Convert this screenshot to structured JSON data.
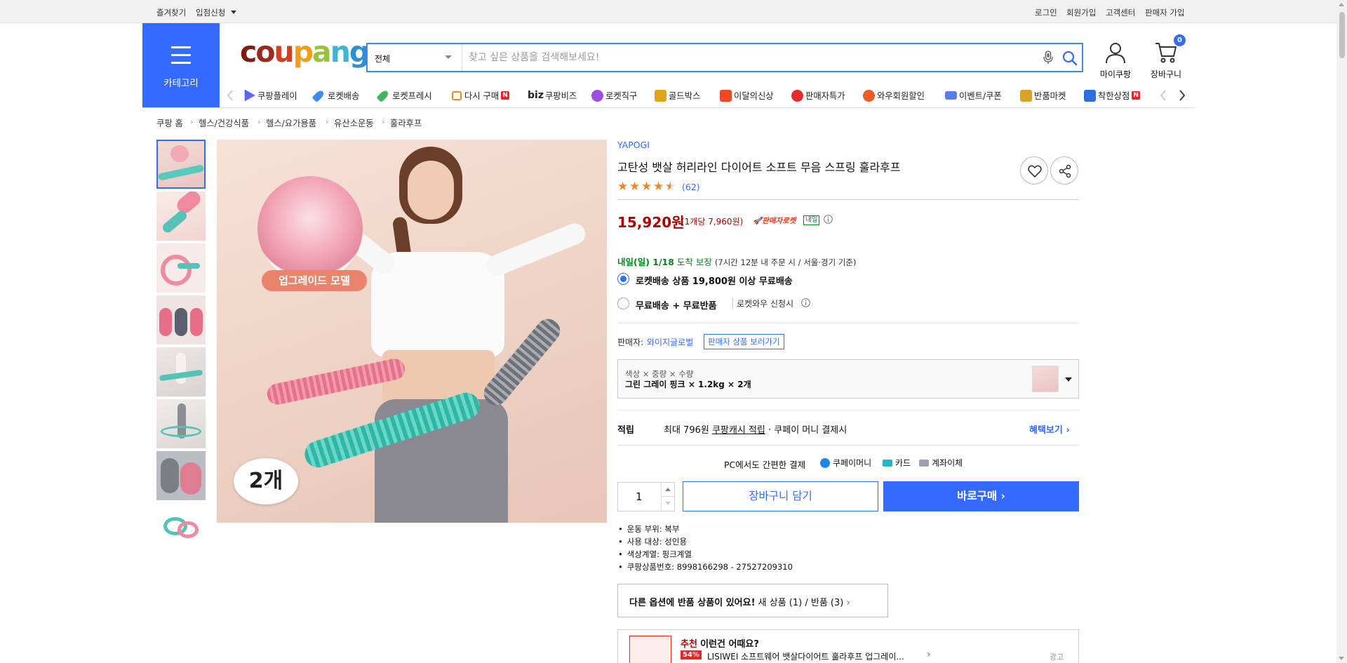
{
  "topbar": {
    "left_links": [
      "즐겨찾기",
      "입점신청"
    ],
    "right_links": [
      "로그인",
      "회원가입",
      "고객센터",
      "판매자 가입"
    ]
  },
  "header": {
    "category_label": "카테고리",
    "logo_text": "coupang",
    "search": {
      "category": "전체",
      "placeholder": "찾고 싶은 상품을 검색해보세요!"
    },
    "mycoupang_label": "마이쿠팡",
    "cart_label": "장바구니",
    "cart_count": "0"
  },
  "nav": {
    "items": [
      "쿠팡플레이",
      "로켓배송",
      "로켓프레시",
      "다시 구매",
      "쿠팡비즈",
      "로켓직구",
      "골드박스",
      "이달의신상",
      "판매자특가",
      "와우회원할인",
      "이벤트/쿠폰",
      "반품마켓",
      "착한상점"
    ],
    "biz_prefix": "biz",
    "n_badge": "N"
  },
  "breadcrumb": [
    "쿠팡 홈",
    "헬스/건강식품",
    "헬스/요가용품",
    "유산소운동",
    "훌라후프"
  ],
  "product": {
    "brand": "YAPOGI",
    "title": "고탄성 뱃살 허리라인 다이어트 소프트 무음 스프링 훌라후프",
    "rating": 4.5,
    "review_count": "(62)",
    "price": "15,920원",
    "unit_price": "(1개당 7,960원)",
    "seller_rocket": "판매자로켓",
    "tomorrow_tag": "내일",
    "delivery_date": "내일(일) 1/18",
    "delivery_guarantee": "도착 보장",
    "delivery_note": "(7시간 12분 내 주문 시 / 서울·경기 기준)",
    "option1": "로켓배송 상품 19,800원 이상 무료배송",
    "option2_a": "무료배송 + 무료반품",
    "option2_b": "로켓와우 신청시",
    "seller_label": "판매자:",
    "seller_name": "와이지글로벌",
    "seller_products": "판매자 상품 보러가기",
    "option_header": "색상 × 중량 × 수량",
    "option_value": "그린 그레이 핑크 × 1.2kg × 2개",
    "reward_label": "적립",
    "reward_text_a": "최대 796원",
    "reward_text_b": "쿠팡캐시 적립",
    "reward_text_c": "· 쿠페이 머니 결제시",
    "benefit_link": "혜택보기",
    "pay_title": "PC에서도 간편한 결제",
    "pay_methods": [
      "쿠페이머니",
      "카드",
      "계좌이체"
    ],
    "quantity": "1",
    "cart_button": "장바구니 담기",
    "buy_button": "바로구매",
    "specs": [
      "운동 부위: 복부",
      "사용 대상: 성인용",
      "색상계열: 핑크계열",
      "쿠팡상품번호: 8998166298 - 27527209310"
    ],
    "alt_notice_a": "다른 옵션에 반품 상품이 있어요!",
    "alt_notice_b": "새 상품 (1) / 반품 (3)",
    "rec_label_a": "추천",
    "rec_label_b": "이런건 어때요?",
    "rec_discount": "54%",
    "rec_title": "LISIWEI 소프트웨어 뱃살다이어트 훌라후프 업그레이...",
    "ad_label": "광고"
  },
  "images": {
    "main_badge_upgrade": "업그레이드 모델",
    "main_badge_count": "2개"
  },
  "colors": {
    "accent": "#346aff",
    "price_red": "#ae0000",
    "green": "#00891a"
  }
}
